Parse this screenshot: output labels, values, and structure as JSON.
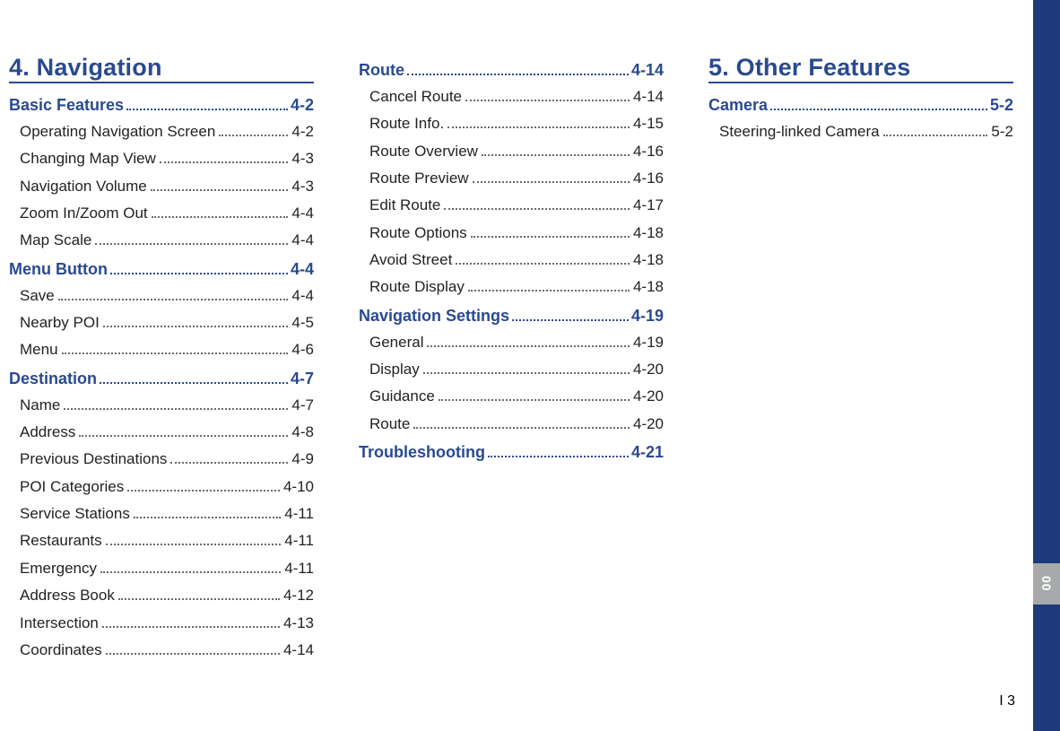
{
  "columns": [
    {
      "chapter": "4. Navigation",
      "groups": [
        {
          "section": {
            "label": "Basic Features ",
            "page": "4-2"
          },
          "entries": [
            {
              "label": "Operating Navigation Screen ",
              "page": " 4-2"
            },
            {
              "label": "Changing Map View ",
              "page": " 4-3"
            },
            {
              "label": "Navigation Volume ",
              "page": " 4-3"
            },
            {
              "label": "Zoom In/Zoom Out  ",
              "page": " 4-4"
            },
            {
              "label": "Map Scale ",
              "page": " 4-4"
            }
          ]
        },
        {
          "section": {
            "label": "Menu Button ",
            "page": "4-4"
          },
          "entries": [
            {
              "label": "Save ",
              "page": " 4-4"
            },
            {
              "label": "Nearby POI ",
              "page": " 4-5"
            },
            {
              "label": "Menu  ",
              "page": " 4-6"
            }
          ]
        },
        {
          "section": {
            "label": "Destination",
            "page": "4-7"
          },
          "entries": [
            {
              "label": "Name ",
              "page": " 4-7"
            },
            {
              "label": "Address ",
              "page": " 4-8"
            },
            {
              "label": "Previous Destinations ",
              "page": " 4-9"
            },
            {
              "label": "POI Categories ",
              "page": " 4-10"
            },
            {
              "label": "Service Stations ",
              "page": " 4-11"
            },
            {
              "label": "Restaurants  ",
              "page": " 4-11"
            },
            {
              "label": "Emergency ",
              "page": " 4-11"
            },
            {
              "label": "Address Book ",
              "page": " 4-12"
            },
            {
              "label": "Intersection ",
              "page": " 4-13"
            },
            {
              "label": "Coordinates  ",
              "page": " 4-14"
            }
          ]
        }
      ]
    },
    {
      "chapter": "",
      "groups": [
        {
          "section": {
            "label": "Route",
            "page": "4-14"
          },
          "entries": [
            {
              "label": "Cancel Route ",
              "page": " 4-14"
            },
            {
              "label": "Route Info. ",
              "page": " 4-15"
            },
            {
              "label": "Route Overview ",
              "page": " 4-16"
            },
            {
              "label": "Route Preview  ",
              "page": " 4-16"
            },
            {
              "label": "Edit Route ",
              "page": " 4-17"
            },
            {
              "label": "Route Options  ",
              "page": " 4-18"
            },
            {
              "label": "Avoid Street  ",
              "page": " 4-18"
            },
            {
              "label": "Route Display ",
              "page": " 4-18"
            }
          ]
        },
        {
          "section": {
            "label": "Navigation Settings ",
            "page": "4-19"
          },
          "entries": [
            {
              "label": "General  ",
              "page": " 4-19"
            },
            {
              "label": "Display ",
              "page": " 4-20"
            },
            {
              "label": "Guidance ",
              "page": " 4-20"
            },
            {
              "label": "Route ",
              "page": " 4-20"
            }
          ]
        },
        {
          "section": {
            "label": "Troubleshooting ",
            "page": "4-21"
          },
          "entries": []
        }
      ]
    },
    {
      "chapter": "5. Other Features",
      "groups": [
        {
          "section": {
            "label": "Camera",
            "page": "5-2"
          },
          "entries": [
            {
              "label": "Steering-linked Camera  ",
              "page": " 5-2"
            }
          ]
        }
      ]
    }
  ],
  "sidebar_tab": "00",
  "page_number": "I 3"
}
